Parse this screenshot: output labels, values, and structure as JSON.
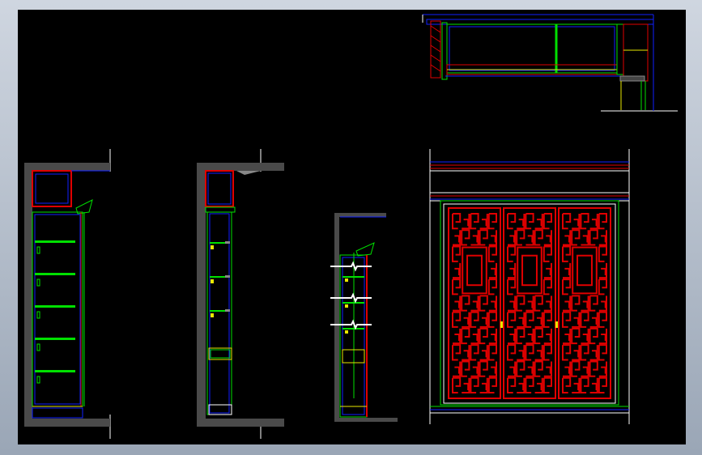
{
  "viewport": {
    "background": "#000000",
    "frame_gradient": [
      "#cfd6e0",
      "#9aa6b6"
    ]
  },
  "colors": {
    "red": "#e00000",
    "green": "#00e000",
    "blue": "#1020ff",
    "yellow": "#e8e800",
    "white": "#ffffff",
    "wall": "#4a4a4a",
    "grey": "#888888"
  },
  "views": [
    {
      "id": "plan",
      "kind": "top plan of cabinet"
    },
    {
      "id": "section-1",
      "kind": "side section with open shelves"
    },
    {
      "id": "section-2",
      "kind": "side section with shelves and drawer"
    },
    {
      "id": "section-3",
      "kind": "side section with break marks"
    },
    {
      "id": "elevation",
      "kind": "front elevation with lattice doors"
    }
  ],
  "elevation": {
    "door_count": 3,
    "lattice_color": "#e00000"
  }
}
